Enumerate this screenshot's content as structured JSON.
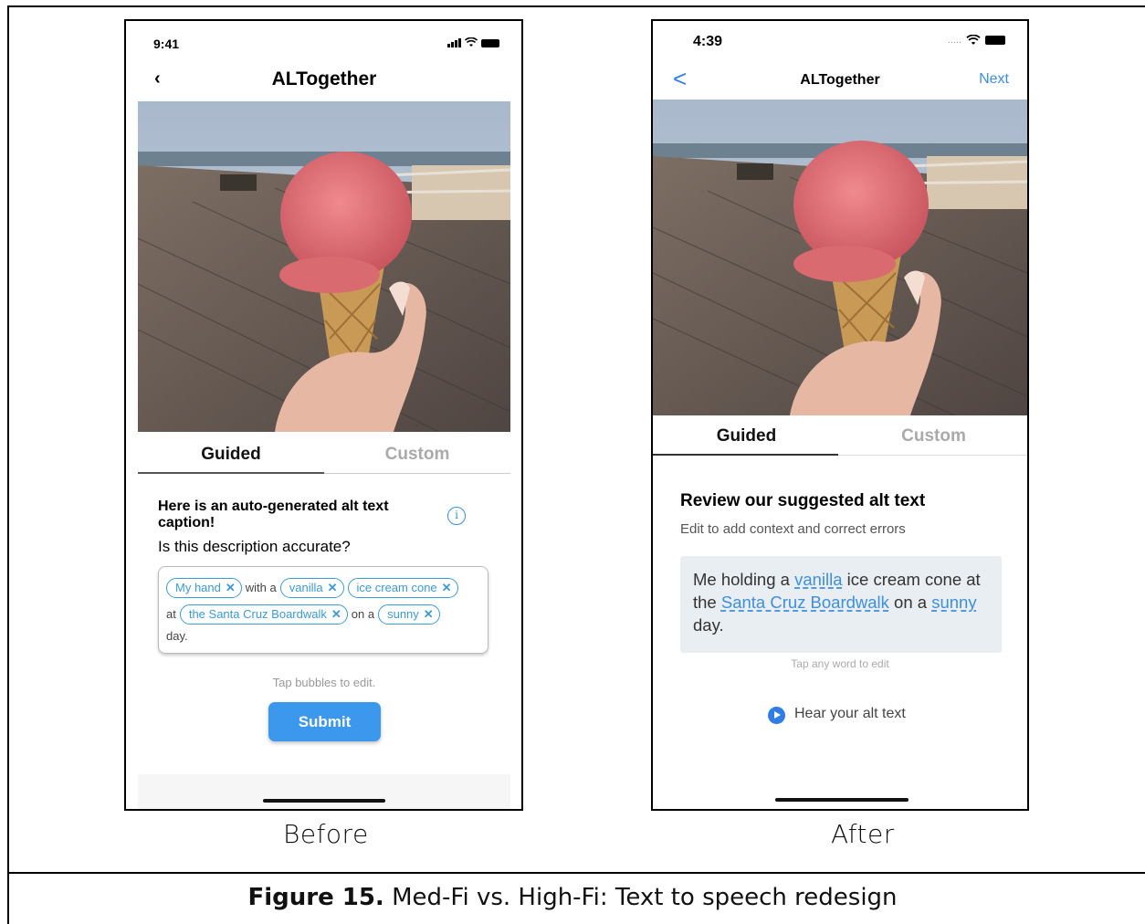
{
  "labels": {
    "before": "Before",
    "after": "After"
  },
  "caption": {
    "figure": "Figure 15.",
    "text": " Med-Fi vs. High-Fi: Text to speech redesign"
  },
  "before": {
    "time": "9:41",
    "back": "‹",
    "title": "ALTogether",
    "tabs": {
      "guided": "Guided",
      "custom": "Custom"
    },
    "heading": "Here is an auto-generated alt text caption!",
    "info": "i",
    "question": "Is this description accurate?",
    "sentence": {
      "chip1": "My hand",
      "w1": "with a",
      "chip2": "vanilla",
      "chip3": "ice cream cone",
      "w2": "at",
      "chip4": "the Santa Cruz Boardwalk",
      "w3": "on a",
      "chip5": "sunny",
      "w4": "day.",
      "remove": "✕"
    },
    "hint": "Tap bubbles to edit.",
    "submit": "Submit"
  },
  "after": {
    "time": "4:39",
    "signal": ".....",
    "back": "<",
    "title": "ALTogether",
    "next": "Next",
    "tabs": {
      "guided": "Guided",
      "custom": "Custom"
    },
    "heading": "Review our suggested alt text",
    "subheading": "Edit to add context and correct errors",
    "alt": {
      "t1": "Me holding a ",
      "l1": "vanilla",
      "t2": " ice cream cone at the ",
      "l2": "Santa Cruz Boardwalk",
      "t3": " on a ",
      "l3": "sunny",
      "t4": " day."
    },
    "hint": "Tap any word to edit",
    "hear": "Hear your alt text"
  }
}
